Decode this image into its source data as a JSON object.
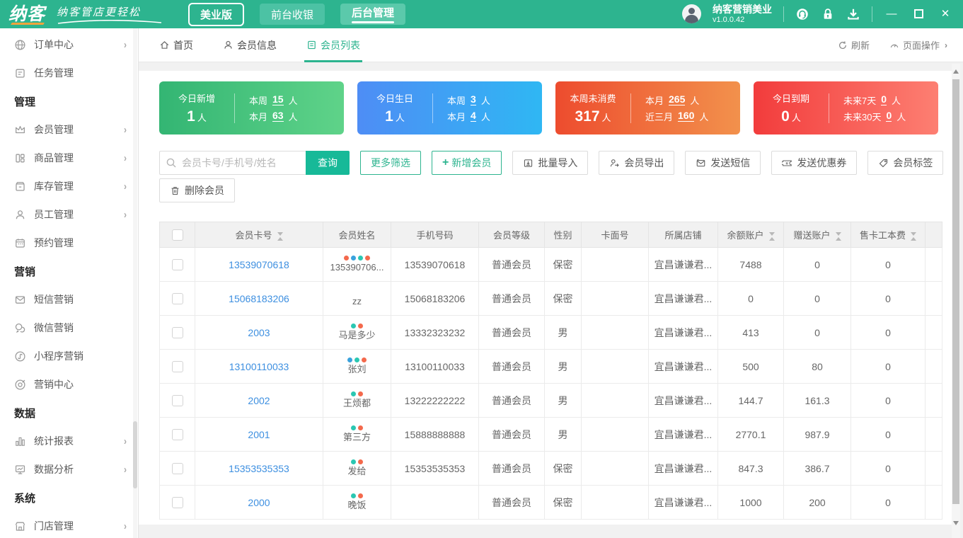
{
  "topbar": {
    "logo": "纳客",
    "slogan": "纳客管店更轻松",
    "edition": "美业版",
    "nav_front": "前台收银",
    "nav_back": "后台管理",
    "user_name": "纳客营销美业",
    "version": "v1.0.0.42"
  },
  "sidebar": {
    "items": [
      {
        "label": "订单中心"
      },
      {
        "label": "任务管理"
      },
      {
        "label": "管理"
      },
      {
        "label": "会员管理"
      },
      {
        "label": "商品管理"
      },
      {
        "label": "库存管理"
      },
      {
        "label": "员工管理"
      },
      {
        "label": "预约管理"
      },
      {
        "label": "营销"
      },
      {
        "label": "短信营销"
      },
      {
        "label": "微信营销"
      },
      {
        "label": "小程序营销"
      },
      {
        "label": "营销中心"
      },
      {
        "label": "数据"
      },
      {
        "label": "统计报表"
      },
      {
        "label": "数据分析"
      },
      {
        "label": "系统"
      },
      {
        "label": "门店管理"
      }
    ]
  },
  "tabs": {
    "home": "首页",
    "member_info": "会员信息",
    "member_list": "会员列表",
    "refresh": "刷新",
    "page_ops": "页面操作"
  },
  "stats": [
    {
      "title": "今日新增",
      "value": "1",
      "unit": "人",
      "line1_label": "本周",
      "line1_value": "15",
      "line2_label": "本月",
      "line2_value": "63"
    },
    {
      "title": "今日生日",
      "value": "1",
      "unit": "人",
      "line1_label": "本周",
      "line1_value": "3",
      "line2_label": "本月",
      "line2_value": "4"
    },
    {
      "title": "本周未消费",
      "value": "317",
      "unit": "人",
      "line1_label": "本月",
      "line1_value": "265",
      "line2_label": "近三月",
      "line2_value": "160"
    },
    {
      "title": "今日到期",
      "value": "0",
      "unit": "人",
      "line1_label": "未来7天",
      "line1_value": "0",
      "line2_label": "未来30天",
      "line2_value": "0"
    }
  ],
  "toolbar": {
    "search_placeholder": "会员卡号/手机号/姓名",
    "query": "查询",
    "more_filter": "更多筛选",
    "add_member": "新增会员",
    "batch_import": "批量导入",
    "member_export": "会员导出",
    "send_sms": "发送短信",
    "send_coupon": "发送优惠券",
    "member_tag": "会员标签",
    "delete_member": "删除会员"
  },
  "table": {
    "headers": {
      "card": "会员卡号",
      "name": "会员姓名",
      "phone": "手机号码",
      "level": "会员等级",
      "gender": "性别",
      "card_face": "卡面号",
      "shop": "所属店铺",
      "balance": "余额账户",
      "gift": "赠送账户",
      "fee": "售卡工本费"
    },
    "rows": [
      {
        "card": "13539070618",
        "name": "135390706...",
        "dots": [
          "#f4694c",
          "#3aa2dd",
          "#2bc7b2",
          "#f4694c"
        ],
        "phone": "13539070618",
        "level": "普通会员",
        "gender": "保密",
        "card_face": "",
        "shop": "宜昌谦谦君...",
        "balance": "7488",
        "gift": "0",
        "fee": "0"
      },
      {
        "card": "15068183206",
        "name": "zz",
        "dots": [],
        "phone": "15068183206",
        "level": "普通会员",
        "gender": "保密",
        "card_face": "",
        "shop": "宜昌谦谦君...",
        "balance": "0",
        "gift": "0",
        "fee": "0"
      },
      {
        "card": "2003",
        "name": "马是多少",
        "dots": [
          "#2bc7b2",
          "#f4694c"
        ],
        "phone": "13332323232",
        "level": "普通会员",
        "gender": "男",
        "card_face": "",
        "shop": "宜昌谦谦君...",
        "balance": "413",
        "gift": "0",
        "fee": "0"
      },
      {
        "card": "13100110033",
        "name": "张刘",
        "dots": [
          "#3aa2dd",
          "#2bc7b2",
          "#f4694c"
        ],
        "phone": "13100110033",
        "level": "普通会员",
        "gender": "男",
        "card_face": "",
        "shop": "宜昌谦谦君...",
        "balance": "500",
        "gift": "80",
        "fee": "0"
      },
      {
        "card": "2002",
        "name": "王烦都",
        "dots": [
          "#2bc7b2",
          "#f4694c"
        ],
        "phone": "13222222222",
        "level": "普通会员",
        "gender": "男",
        "card_face": "",
        "shop": "宜昌谦谦君...",
        "balance": "144.7",
        "gift": "161.3",
        "fee": "0"
      },
      {
        "card": "2001",
        "name": "第三方",
        "dots": [
          "#2bc7b2",
          "#f4694c"
        ],
        "phone": "15888888888",
        "level": "普通会员",
        "gender": "男",
        "card_face": "",
        "shop": "宜昌谦谦君...",
        "balance": "2770.1",
        "gift": "987.9",
        "fee": "0"
      },
      {
        "card": "15353535353",
        "name": "发给",
        "dots": [
          "#2bc7b2",
          "#f4694c"
        ],
        "phone": "15353535353",
        "level": "普通会员",
        "gender": "保密",
        "card_face": "",
        "shop": "宜昌谦谦君...",
        "balance": "847.3",
        "gift": "386.7",
        "fee": "0"
      },
      {
        "card": "2000",
        "name": "晚饭",
        "dots": [
          "#2bc7b2",
          "#f4694c"
        ],
        "phone": "",
        "level": "普通会员",
        "gender": "保密",
        "card_face": "",
        "shop": "宜昌谦谦君...",
        "balance": "1000",
        "gift": "200",
        "fee": "0"
      }
    ]
  }
}
